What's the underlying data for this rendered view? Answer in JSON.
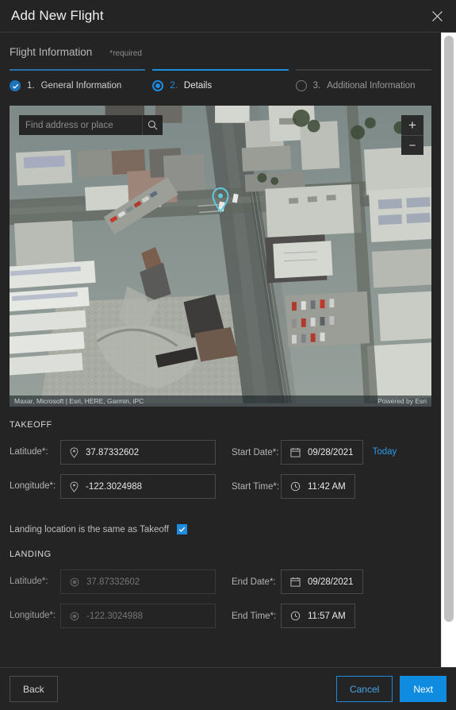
{
  "dialog": {
    "title": "Add New Flight",
    "close_icon": "close-icon"
  },
  "section": {
    "heading": "Flight Information",
    "required_note": "*required"
  },
  "stepper": {
    "steps": [
      {
        "num": "1.",
        "label": "General Information",
        "state": "done",
        "icon": "check-circle-icon"
      },
      {
        "num": "2.",
        "label": "Details",
        "state": "active",
        "icon": "radio-selected-icon"
      },
      {
        "num": "3.",
        "label": "Additional Information",
        "state": "todo",
        "icon": "radio-empty-icon"
      }
    ]
  },
  "map": {
    "search_placeholder": "Find address or place",
    "search_value": "",
    "search_icon": "search-icon",
    "zoom_in_label": "+",
    "zoom_out_label": "−",
    "pin_icon": "map-pin-icon",
    "pin_color": "#5ec8dd",
    "attribution": "Maxar, Microsoft | Esri, HERE, Garmin, iPC",
    "powered_by": "Powered by Esri"
  },
  "takeoff": {
    "group_title": "TAKEOFF",
    "latitude_label": "Latitude*:",
    "latitude_value": "37.87332602",
    "latitude_icon": "location-marker-icon",
    "longitude_label": "Longitude*:",
    "longitude_value": "-122.3024988",
    "longitude_icon": "location-marker-icon",
    "start_date_label": "Start Date*:",
    "start_date_value": "09/28/2021",
    "start_date_icon": "calendar-icon",
    "today_link": "Today",
    "start_time_label": "Start Time*:",
    "start_time_value": "11:42  AM",
    "start_time_icon": "clock-icon"
  },
  "same_location": {
    "label": "Landing location is the same as Takeoff",
    "checked": true,
    "check_icon": "checkmark-icon"
  },
  "landing": {
    "group_title": "LANDING",
    "latitude_label": "Latitude*:",
    "latitude_value": "37.87332602",
    "latitude_icon": "location-disabled-icon",
    "longitude_label": "Longitude*:",
    "longitude_value": "-122.3024988",
    "longitude_icon": "location-disabled-icon",
    "end_date_label": "End Date*:",
    "end_date_value": "09/28/2021",
    "end_date_icon": "calendar-icon",
    "end_time_label": "End Time*:",
    "end_time_value": "11:57  AM",
    "end_time_icon": "clock-icon"
  },
  "footer": {
    "back_label": "Back",
    "cancel_label": "Cancel",
    "next_label": "Next"
  },
  "colors": {
    "accent": "#1f8cdf",
    "accent_button": "#0f8ce0",
    "link": "#2c9ae8",
    "dialog_bg": "#242424",
    "pin": "#5ec8dd"
  }
}
